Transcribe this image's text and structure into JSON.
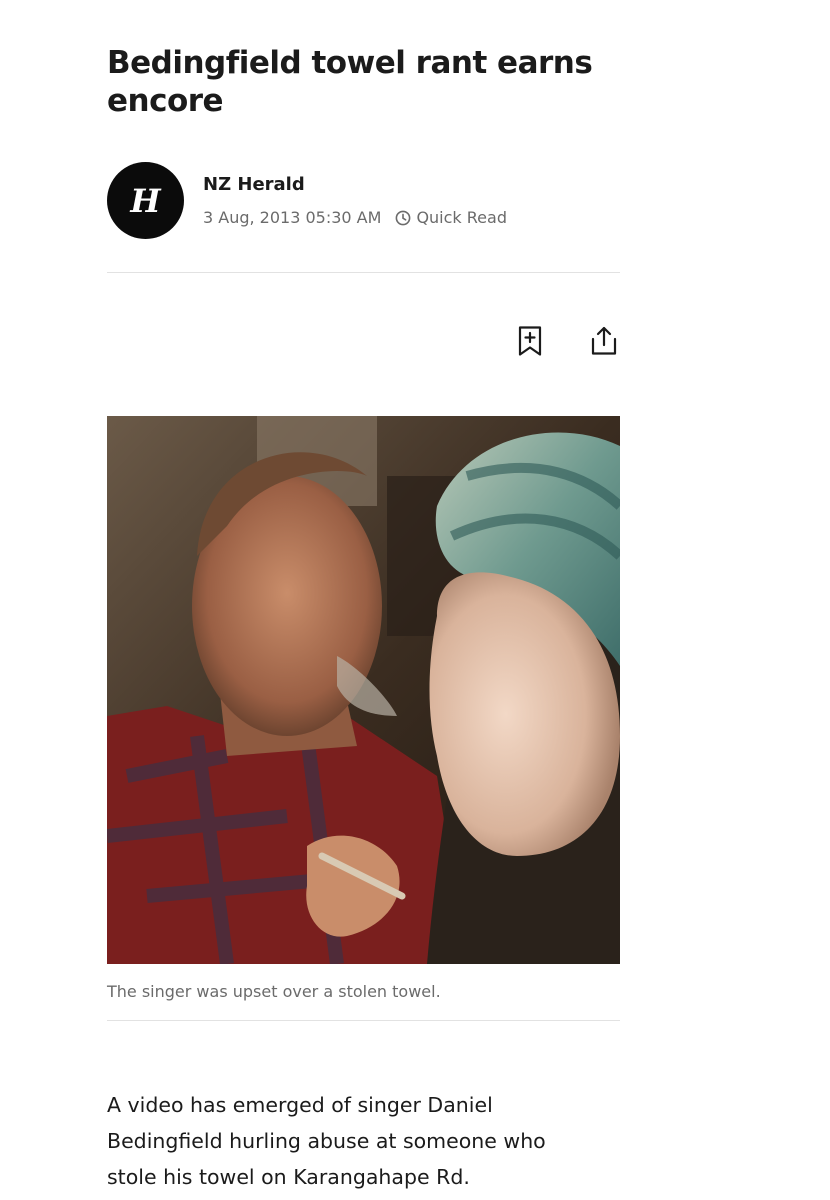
{
  "article": {
    "headline": "Bedingfield towel rant earns encore",
    "author": {
      "name": "NZ Herald",
      "logo_letter": "H",
      "logo_icon": "nz-herald-logo"
    },
    "published": "3 Aug, 2013 05:30 AM",
    "read_time": "Quick Read",
    "actions": {
      "bookmark_icon": "bookmark-add-icon",
      "share_icon": "share-icon"
    },
    "image": {
      "caption": "The singer was upset over a stolen towel."
    },
    "body_lines": [
      "A video has emerged of singer Daniel",
      "Bedingfield hurling abuse at someone who",
      "stole his towel on Karangahape Rd."
    ]
  },
  "colors": {
    "text": "#1b1b1b",
    "muted": "#6b6b6b",
    "divider": "#e2e2e2",
    "logo_bg": "#0b0b0b"
  }
}
